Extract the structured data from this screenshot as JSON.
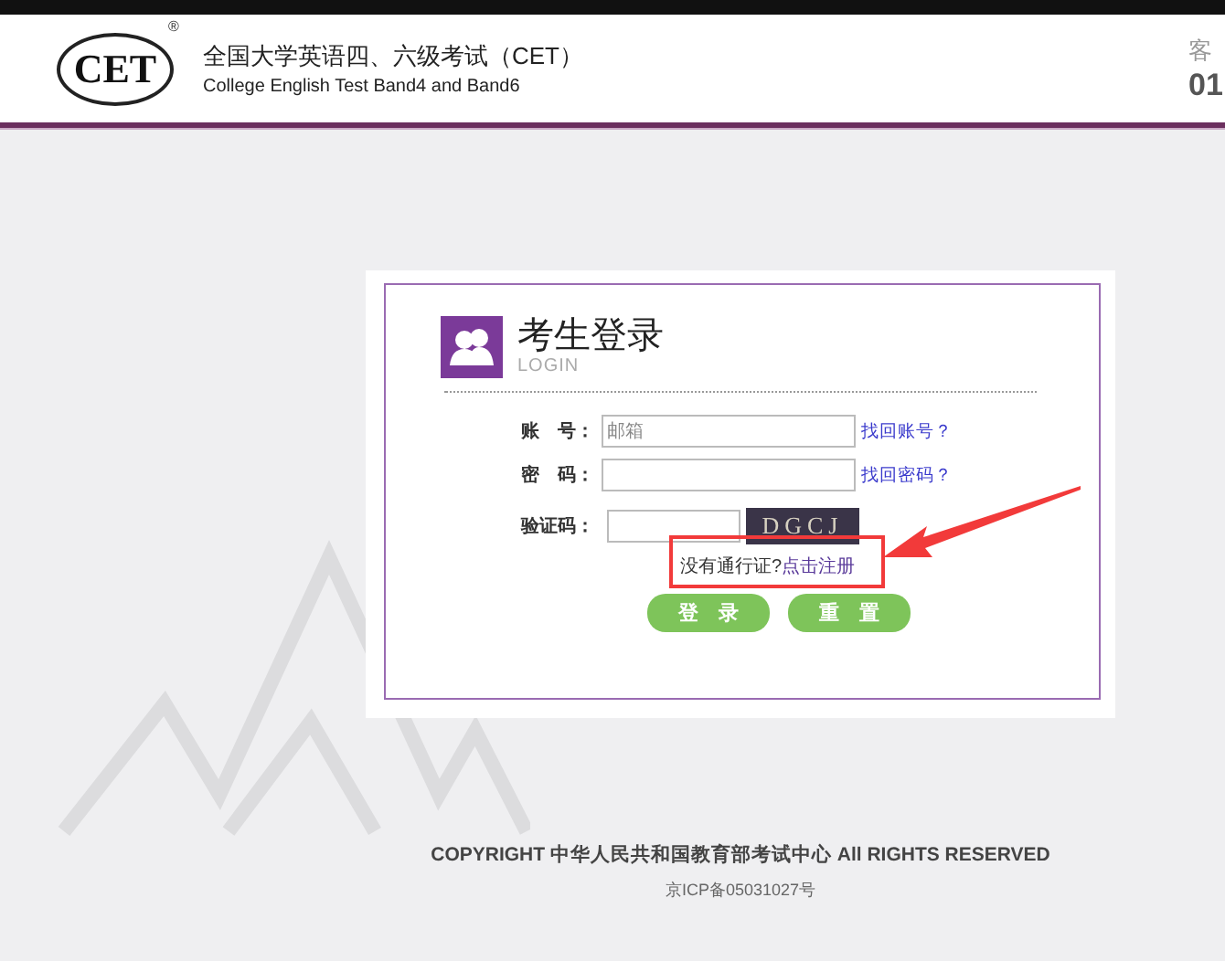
{
  "header": {
    "title": "全国大学英语四、六级考试（CET）",
    "subtitle": "College English Test Band4 and Band6",
    "logo": "CET",
    "logo_mark": "®",
    "service_label": "客",
    "service_number": "01"
  },
  "login": {
    "title": "考生登录",
    "subtitle": "LOGIN",
    "fields": [
      {
        "label": "账　号：",
        "placeholder": "邮箱",
        "link": "找回账号？",
        "kind": "text"
      },
      {
        "label": "密　码：",
        "link": "找回密码？",
        "kind": "text"
      },
      {
        "label": "验证码：",
        "captcha": "DGCJ",
        "kind": "captcha"
      }
    ],
    "register_prompt": "没有通行证?",
    "register_link": "点击注册",
    "buttons": [
      "登　录",
      "重　置"
    ]
  },
  "annotation": {
    "highlight": true
  },
  "footer": {
    "copyright": "COPYRIGHT 中华人民共和国教育部考试中心 All RIGHTS RESERVED",
    "icp": "京ICP备05031027号"
  }
}
